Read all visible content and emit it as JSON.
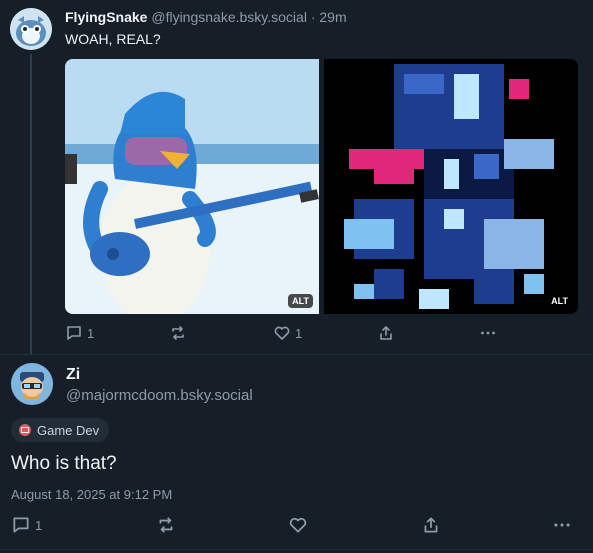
{
  "parent_post": {
    "display_name": "FlyingSnake",
    "handle": "@flyingsnake.bsky.social",
    "separator": "·",
    "time_ago": "29m",
    "text": "WOAH, REAL?",
    "images": [
      {
        "alt_badge": "ALT",
        "subject": "3d-penguin-guitar"
      },
      {
        "alt_badge": "ALT",
        "subject": "pixel-art-character"
      }
    ],
    "actions": {
      "reply_count": "1",
      "repost_count": "",
      "like_count": "1"
    }
  },
  "main_post": {
    "display_name": "Zi",
    "handle": "@majormcdoom.bsky.social",
    "label": "Game Dev",
    "text": "Who is that?",
    "timestamp": "August 18, 2025 at 9:12 PM",
    "actions": {
      "reply_count": "1",
      "repost_count": "",
      "like_count": ""
    }
  },
  "colors": {
    "background": "#161e27",
    "text_primary": "#f1f3f5",
    "text_muted": "#8e9bab",
    "label_icon": "#e05b5b"
  }
}
